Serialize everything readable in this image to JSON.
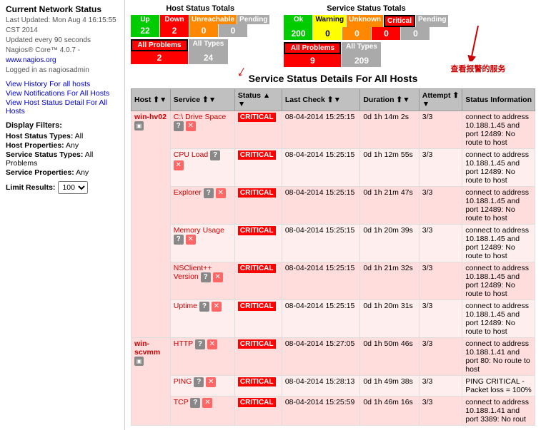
{
  "sidebar": {
    "title": "Current Network Status",
    "meta": {
      "last_updated": "Last Updated: Mon Aug 4 16:15:55 CST 2014",
      "update_interval": "Updated every 90 seconds",
      "nagios_version": "Nagios® Core™ 4.0.7 -",
      "nagios_url": "www.nagios.org",
      "logged_in": "Logged in as nagiosadmin"
    },
    "links": [
      {
        "label": "View History For all hosts",
        "url": "#"
      },
      {
        "label": "View Notifications For All Hosts",
        "url": "#"
      },
      {
        "label": "View Host Status Detail For All Hosts",
        "url": "#"
      }
    ],
    "filters": {
      "title": "Display Filters:",
      "host_status_types_label": "Host Status Types:",
      "host_status_types_value": "All",
      "host_properties_label": "Host Properties:",
      "host_properties_value": "Any",
      "service_status_types_label": "Service Status Types:",
      "service_status_types_value": "All Problems",
      "service_properties_label": "Service Properties:",
      "service_properties_value": "Any"
    },
    "limit_label": "Limit Results:",
    "limit_value": "100"
  },
  "host_totals": {
    "title": "Host Status Totals",
    "headers": [
      "Up",
      "Down",
      "Unreachable",
      "Pending"
    ],
    "values": [
      "22",
      "2",
      "0",
      "0"
    ],
    "all_problems_label": "All Problems",
    "all_types_label": "All Types",
    "all_problems_value": "2",
    "all_types_value": "24"
  },
  "service_totals": {
    "title": "Service Status Totals",
    "headers": [
      "Ok",
      "Warning",
      "Unknown",
      "Critical",
      "Pending"
    ],
    "values": [
      "200",
      "0",
      "0",
      "0",
      "0"
    ],
    "all_problems_label": "All Problems",
    "all_types_label": "All Types",
    "all_problems_value": "9",
    "all_types_value": "209"
  },
  "annotation": "查看报警的服务",
  "section_title": "Service Status Details For All Hosts",
  "table": {
    "columns": [
      "Host",
      "Service",
      "Status",
      "Last Check",
      "Duration",
      "Attempt",
      "Status Information"
    ],
    "rows": [
      {
        "host": "win-hv02",
        "host_rowspan": 6,
        "service": "C:\\ Drive Space",
        "status": "CRITICAL",
        "last_check": "08-04-2014 15:25:15",
        "duration": "0d 1h 14m 2s",
        "attempt": "3/3",
        "info": "connect to address 10.188.1.45 and port 12489: No route to host"
      },
      {
        "host": "",
        "service": "CPU Load",
        "status": "CRITICAL",
        "last_check": "08-04-2014 15:25:15",
        "duration": "0d 1h 12m 55s",
        "attempt": "3/3",
        "info": "connect to address 10.188.1.45 and port 12489: No route to host"
      },
      {
        "host": "",
        "service": "Explorer",
        "status": "CRITICAL",
        "last_check": "08-04-2014 15:25:15",
        "duration": "0d 1h 21m 47s",
        "attempt": "3/3",
        "info": "connect to address 10.188.1.45 and port 12489: No route to host"
      },
      {
        "host": "",
        "service": "Memory Usage",
        "status": "CRITICAL",
        "last_check": "08-04-2014 15:25:15",
        "duration": "0d 1h 20m 39s",
        "attempt": "3/3",
        "info": "connect to address 10.188.1.45 and port 12489: No route to host"
      },
      {
        "host": "",
        "service": "NSClient++ Version",
        "status": "CRITICAL",
        "last_check": "08-04-2014 15:25:15",
        "duration": "0d 1h 21m 32s",
        "attempt": "3/3",
        "info": "connect to address 10.188.1.45 and port 12489: No route to host"
      },
      {
        "host": "",
        "service": "Uptime",
        "status": "CRITICAL",
        "last_check": "08-04-2014 15:25:15",
        "duration": "0d 1h 20m 31s",
        "attempt": "3/3",
        "info": "connect to address 10.188.1.45 and port 12489: No route to host"
      },
      {
        "host": "win-scvmm",
        "host_rowspan": 3,
        "service": "HTTP",
        "status": "CRITICAL",
        "last_check": "08-04-2014 15:27:05",
        "duration": "0d 1h 50m 46s",
        "attempt": "3/3",
        "info": "connect to address 10.188.1.41 and port 80: No route to host"
      },
      {
        "host": "",
        "service": "PING",
        "status": "CRITICAL",
        "last_check": "08-04-2014 15:28:13",
        "duration": "0d 1h 49m 38s",
        "attempt": "3/3",
        "info": "PING CRITICAL - Packet loss = 100%"
      },
      {
        "host": "",
        "service": "TCP",
        "status": "CRITICAL",
        "last_check": "08-04-2014 15:25:59",
        "duration": "0d 1h 46m 16s",
        "attempt": "3/3",
        "info": "connect to address 10.188.1.41 and port 3389: No rout"
      }
    ]
  },
  "icons": {
    "question": "?",
    "x_mark": "✕",
    "sort_up": "▲",
    "sort_down": "▼",
    "sort_both": "⬆"
  }
}
